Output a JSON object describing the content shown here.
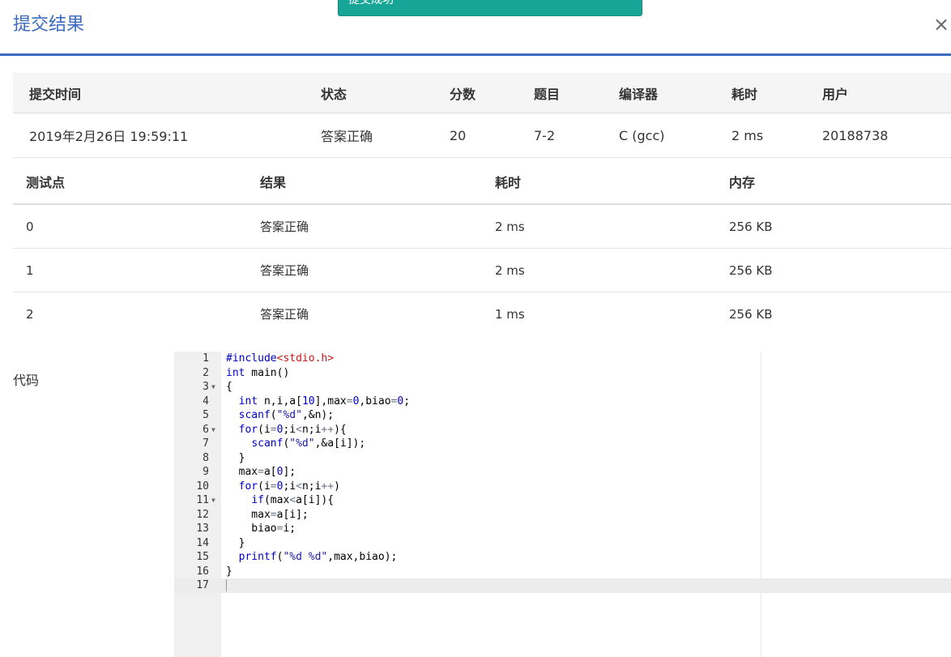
{
  "toast": {
    "text": "提交成功"
  },
  "header": {
    "title": "提交结果",
    "close_label": "×"
  },
  "submission": {
    "headers": [
      "提交时间",
      "状态",
      "分数",
      "题目",
      "编译器",
      "耗时",
      "用户"
    ],
    "row": {
      "time": "2019年2月26日 19:59:11",
      "status": "答案正确",
      "score": "20",
      "problem": "7-2",
      "compiler": "C (gcc)",
      "duration": "2 ms",
      "user": "20188738"
    }
  },
  "cases": {
    "headers": [
      "测试点",
      "结果",
      "耗时",
      "内存"
    ],
    "rows": [
      {
        "id": "0",
        "result": "答案正确",
        "time": "2 ms",
        "memory": "256 KB"
      },
      {
        "id": "1",
        "result": "答案正确",
        "time": "2 ms",
        "memory": "256 KB"
      },
      {
        "id": "2",
        "result": "答案正确",
        "time": "1 ms",
        "memory": "256 KB"
      }
    ]
  },
  "code_section": {
    "label": "代码",
    "lines": [
      "#include<stdio.h>",
      "int main()",
      "{",
      "  int n,i,a[10],max=0,biao=0;",
      "  scanf(\"%d\",&n);",
      "  for(i=0;i<n;i++){",
      "    scanf(\"%d\",&a[i]);",
      "  }",
      "  max=a[0];",
      "  for(i=0;i<n;i++)",
      "    if(max<a[i]){",
      "    max=a[i];",
      "    biao=i;",
      "  }",
      "  printf(\"%d %d\",max,biao);",
      "}",
      ""
    ],
    "fold_lines": [
      3,
      6,
      11
    ],
    "active_line": 17
  },
  "colors": {
    "accent": "#3d6bbf",
    "success_text": "#e0443a",
    "toast_bg": "#16a596",
    "link": "#2d63b5"
  }
}
